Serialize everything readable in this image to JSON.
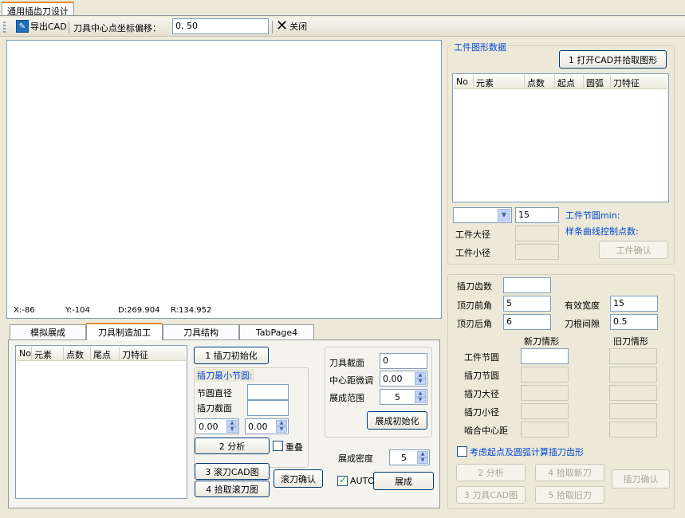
{
  "doc_tab": "通用插齿刀设计",
  "toolbar": {
    "export_cad": "导出CAD",
    "offset_label": "刀具中心点坐标偏移：",
    "offset_value": "0, 50",
    "close": "关闭"
  },
  "canvas_status": {
    "x": "X:-86",
    "y": "Y:-104",
    "d": "D:269.904",
    "r": "R:134.952"
  },
  "tabs": [
    "模拟展成",
    "刀具制造加工",
    "刀具结构",
    "TabPage4"
  ],
  "tool_list": {
    "columns": [
      "No",
      "元素",
      "点数",
      "尾点",
      "刀特征"
    ]
  },
  "tool_panel": {
    "init_btn": "1 插刀初始化",
    "min_pitch_title": "插刀最小节圆:",
    "pitch_dia_label": "节圆直径",
    "tool_section_label": "插刀截面",
    "spin1": "0.00",
    "spin2": "0.00",
    "analyze_btn": "2  分析",
    "overlap_label": "重叠",
    "hob_cad_btn": "3 滚刀CAD图",
    "pick_hob_btn": "4 拾取滚刀图",
    "hob_confirm_btn": "滚刀确认",
    "section_label": "刀具截面",
    "section_value": "0",
    "center_adjust_label": "中心距微调",
    "center_adjust_value": "0.00",
    "range_label": "展成范围",
    "range_value": "5",
    "gen_init_btn": "展成初始化",
    "density_label": "展成密度",
    "density_value": "5",
    "auto_label": "AUTO",
    "generate_btn": "展成"
  },
  "workpiece": {
    "group_title": "工件图形数据",
    "open_cad_btn": "1 打开CAD并拾取图形",
    "columns": [
      "No",
      "元素",
      "点数",
      "起点",
      "圆弧",
      "刀特征"
    ],
    "combo_value": "",
    "count_value": "15",
    "pitch_min_label": "工件节圆min:",
    "spline_label": "样条曲线控制点数:",
    "major_dia_label": "工件大径",
    "minor_dia_label": "工件小径",
    "confirm_btn": "工件确认"
  },
  "cutter": {
    "teeth_label": "插刀齿数",
    "teeth_value": "",
    "top_rake_label": "顶刃前角",
    "top_rake_value": "5",
    "top_relief_label": "顶刃后角",
    "top_relief_value": "6",
    "eff_width_label": "有效宽度",
    "eff_width_value": "15",
    "root_gap_label": "刀根间隙",
    "root_gap_value": "0.5",
    "new_label": "新刀情形",
    "old_label": "旧刀情形",
    "rows": [
      "工件节圆",
      "插刀节圆",
      "插刀大径",
      "插刀小径",
      "啮合中心距"
    ],
    "consider_label": "考虑起点及圆弧计算插刀齿形",
    "analyze_btn": "2 分析",
    "pick_new_btn": "4 拾取新刀",
    "confirm_btn": "插刀确认",
    "cad_btn": "3 刀具CAD图",
    "pick_old_btn": "5 拾取旧刀"
  }
}
